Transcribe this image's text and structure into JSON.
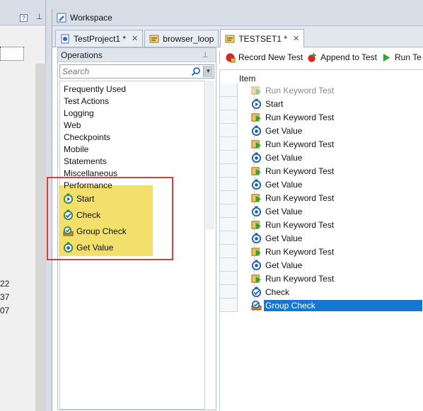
{
  "left_panel": {
    "numbers": [
      "22",
      "37",
      "07"
    ]
  },
  "workspace": {
    "title": "Workspace",
    "tabs": [
      {
        "label": "TestProject1 *",
        "active": false
      },
      {
        "label": "browser_loop",
        "active": false
      },
      {
        "label": "TESTSET1 *",
        "active": true
      }
    ]
  },
  "operations": {
    "title": "Operations",
    "search_placeholder": "Search",
    "categories": [
      "Frequently Used",
      "Test Actions",
      "Logging",
      "Web",
      "Checkpoints",
      "Mobile",
      "Statements",
      "Miscellaneous",
      "Performance"
    ],
    "highlighted_items": [
      {
        "label": "Start",
        "icon": "start-icon"
      },
      {
        "label": "Check",
        "icon": "check-icon"
      },
      {
        "label": "Group Check",
        "icon": "group-check-icon"
      },
      {
        "label": "Get Value",
        "icon": "get-value-icon"
      }
    ]
  },
  "toolbar": {
    "record_new_test": "Record New Test",
    "append_to_test": "Append to Test",
    "run": "Run Te"
  },
  "tree": {
    "header": "Item",
    "rows": [
      {
        "label": "Run Keyword Test",
        "icon": "run-keyword-test-icon",
        "dim": true
      },
      {
        "label": "Start",
        "icon": "start-icon"
      },
      {
        "label": "Run Keyword Test",
        "icon": "run-keyword-test-icon"
      },
      {
        "label": "Get Value",
        "icon": "get-value-icon"
      },
      {
        "label": "Run Keyword Test",
        "icon": "run-keyword-test-icon"
      },
      {
        "label": "Get Value",
        "icon": "get-value-icon"
      },
      {
        "label": "Run Keyword Test",
        "icon": "run-keyword-test-icon"
      },
      {
        "label": "Get Value",
        "icon": "get-value-icon"
      },
      {
        "label": "Run Keyword Test",
        "icon": "run-keyword-test-icon"
      },
      {
        "label": "Get Value",
        "icon": "get-value-icon"
      },
      {
        "label": "Run Keyword Test",
        "icon": "run-keyword-test-icon"
      },
      {
        "label": "Get Value",
        "icon": "get-value-icon"
      },
      {
        "label": "Run Keyword Test",
        "icon": "run-keyword-test-icon"
      },
      {
        "label": "Get Value",
        "icon": "get-value-icon"
      },
      {
        "label": "Run Keyword Test",
        "icon": "run-keyword-test-icon"
      },
      {
        "label": "Check",
        "icon": "check-icon"
      },
      {
        "label": "Group Check",
        "icon": "group-check-icon",
        "selected": true
      }
    ]
  },
  "colors": {
    "selection": "#1677d2",
    "highlight": "#f3e06c",
    "annotation_border": "#e0393f"
  }
}
